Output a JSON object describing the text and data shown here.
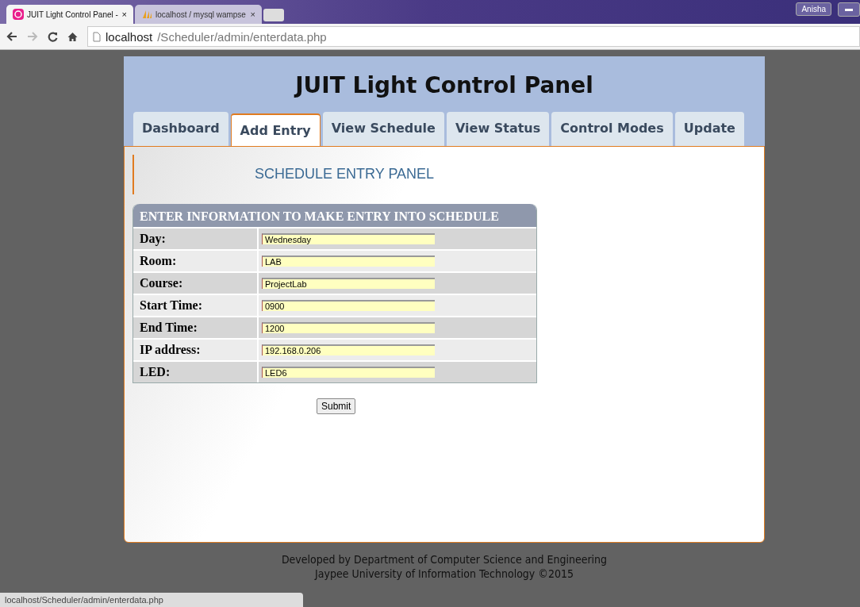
{
  "browser": {
    "tabs": [
      {
        "title": "JUIT Light Control Panel -",
        "close": "×",
        "selected": true
      },
      {
        "title": "localhost / mysql wampse",
        "close": "×",
        "selected": false
      }
    ],
    "user": "Anisha",
    "address": {
      "host": "localhost",
      "path": "/Scheduler/admin/enterdata.php"
    }
  },
  "header": {
    "title": "JUIT Light Control Panel"
  },
  "tabs": [
    {
      "label": "Dashboard",
      "selected": false
    },
    {
      "label": "Add Entry",
      "selected": true
    },
    {
      "label": "View Schedule",
      "selected": false
    },
    {
      "label": "View Status",
      "selected": false
    },
    {
      "label": "Control Modes",
      "selected": false
    },
    {
      "label": "Update",
      "selected": false
    }
  ],
  "panel": {
    "title": "SCHEDULE ENTRY PANEL",
    "form_title": "ENTER INFORMATION TO MAKE ENTRY INTO SCHEDULE",
    "fields": [
      {
        "label": "Day:",
        "value": "Wednesday"
      },
      {
        "label": "Room:",
        "value": "LAB"
      },
      {
        "label": "Course:",
        "value": "ProjectLab"
      },
      {
        "label": "Start Time:",
        "value": "0900"
      },
      {
        "label": "End Time:",
        "value": "1200"
      },
      {
        "label": "IP address:",
        "value": "192.168.0.206"
      },
      {
        "label": "LED:",
        "value": "LED6"
      }
    ],
    "submit": "Submit"
  },
  "footer": {
    "lines": [
      "Developed by Department of Computer Science and Engineering",
      "Jaypee University of Information Technology ©2015"
    ]
  },
  "status_bar": "localhost/Scheduler/admin/enterdata.php"
}
